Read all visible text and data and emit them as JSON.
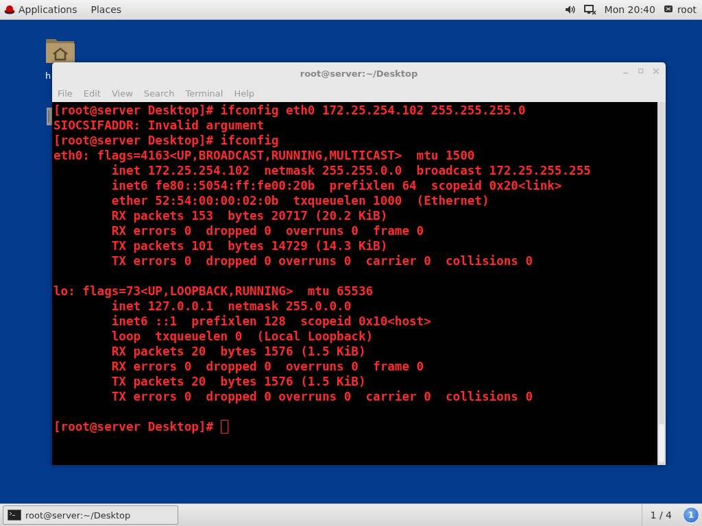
{
  "top_bar": {
    "menus": [
      "Applications",
      "Places"
    ],
    "clock": "Mon 20:40",
    "user": "root"
  },
  "desktop": {
    "icons": [
      {
        "label": "h"
      }
    ]
  },
  "window": {
    "title": "root@server:~/Desktop",
    "menu": [
      "File",
      "Edit",
      "View",
      "Search",
      "Terminal",
      "Help"
    ],
    "lines": [
      {
        "kind": "text",
        "text": "[root@server Desktop]# ifconfig eth0 172.25.254.102 255.255.255.0"
      },
      {
        "kind": "text",
        "text": "SIOCSIFADDR: Invalid argument"
      },
      {
        "kind": "text",
        "text": "[root@server Desktop]# ifconfig"
      },
      {
        "kind": "text",
        "text": "eth0: flags=4163<UP,BROADCAST,RUNNING,MULTICAST>  mtu 1500"
      },
      {
        "kind": "text",
        "text": "        inet 172.25.254.102  netmask 255.255.0.0  broadcast 172.25.255.255"
      },
      {
        "kind": "text",
        "text": "        inet6 fe80::5054:ff:fe00:20b  prefixlen 64  scopeid 0x20<link>"
      },
      {
        "kind": "text",
        "text": "        ether 52:54:00:00:02:0b  txqueuelen 1000  (Ethernet)"
      },
      {
        "kind": "text",
        "text": "        RX packets 153  bytes 20717 (20.2 KiB)"
      },
      {
        "kind": "text",
        "text": "        RX errors 0  dropped 0  overruns 0  frame 0"
      },
      {
        "kind": "text",
        "text": "        TX packets 101  bytes 14729 (14.3 KiB)"
      },
      {
        "kind": "text",
        "text": "        TX errors 0  dropped 0 overruns 0  carrier 0  collisions 0"
      },
      {
        "kind": "blank"
      },
      {
        "kind": "text",
        "text": "lo: flags=73<UP,LOOPBACK,RUNNING>  mtu 65536"
      },
      {
        "kind": "text",
        "text": "        inet 127.0.0.1  netmask 255.0.0.0"
      },
      {
        "kind": "text",
        "text": "        inet6 ::1  prefixlen 128  scopeid 0x10<host>"
      },
      {
        "kind": "text",
        "text": "        loop  txqueuelen 0  (Local Loopback)"
      },
      {
        "kind": "text",
        "text": "        RX packets 20  bytes 1576 (1.5 KiB)"
      },
      {
        "kind": "text",
        "text": "        RX errors 0  dropped 0  overruns 0  frame 0"
      },
      {
        "kind": "text",
        "text": "        TX packets 20  bytes 1576 (1.5 KiB)"
      },
      {
        "kind": "text",
        "text": "        TX errors 0  dropped 0 overruns 0  carrier 0  collisions 0"
      },
      {
        "kind": "blank"
      },
      {
        "kind": "prompt",
        "text": "[root@server Desktop]# "
      }
    ]
  },
  "taskbar": {
    "tasks": [
      {
        "label": "root@server:~/Desktop"
      }
    ],
    "workspace": "1 / 4",
    "notifications": "1"
  }
}
